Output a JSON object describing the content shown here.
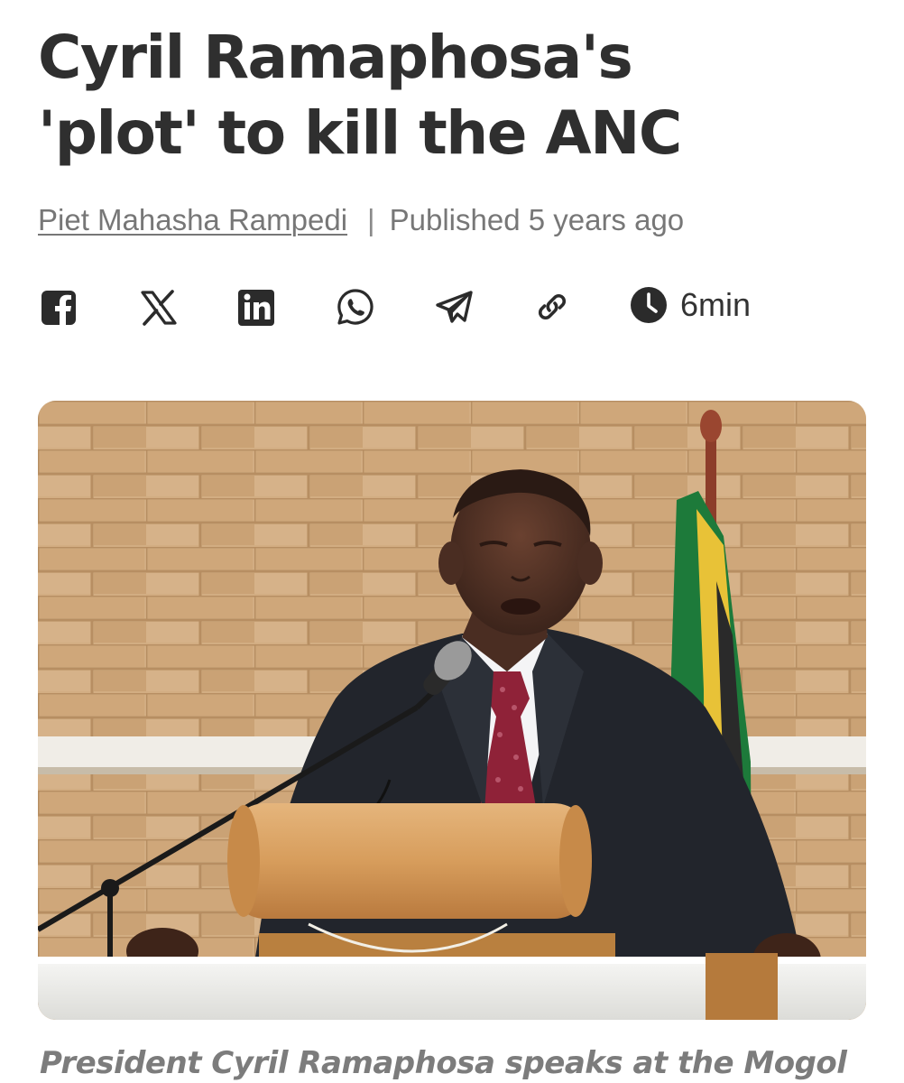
{
  "article": {
    "title_line1": "Cyril Ramaphosa's",
    "title_line2": "'plot' to kill the ANC",
    "author": "Piet Mahasha Rampedi",
    "separator": "|",
    "published": "Published 5 years ago",
    "read_time": "6min",
    "caption": "President Cyril Ramaphosa speaks at the Mogol"
  },
  "share": {
    "icons": [
      "facebook-icon",
      "x-icon",
      "linkedin-icon",
      "whatsapp-icon",
      "telegram-icon",
      "link-icon"
    ],
    "clock_icon": "clock-icon"
  },
  "colors": {
    "text": "#2f2f2f",
    "meta": "#777777",
    "caption": "#7c7c7c",
    "brick": "#c8a277"
  }
}
